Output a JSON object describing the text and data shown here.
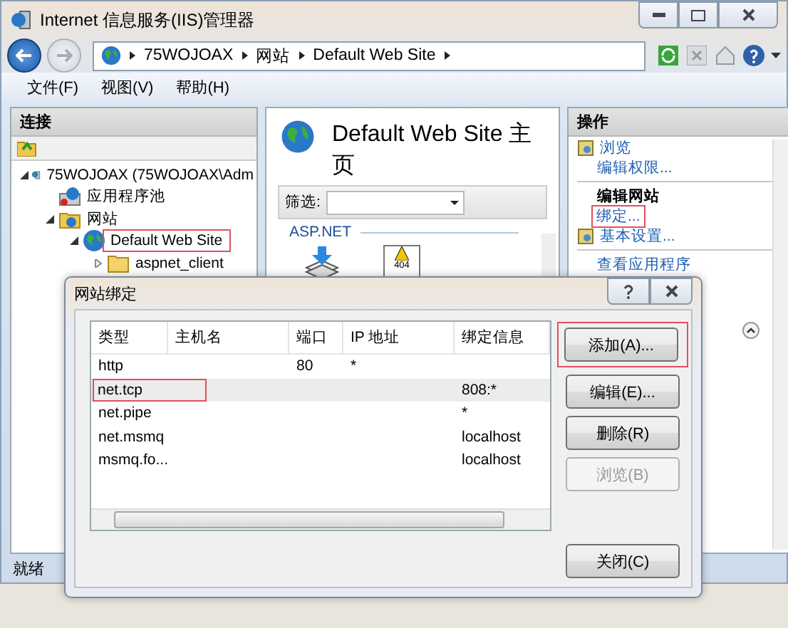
{
  "window": {
    "title": "Internet 信息服务(IIS)管理器"
  },
  "address_bar": {
    "crumbs": [
      "75WOJOAX",
      "网站",
      "Default Web Site"
    ]
  },
  "menu": [
    "文件(F)",
    "视图(V)",
    "帮助(H)"
  ],
  "connections": {
    "header": "连接",
    "tree": [
      {
        "label": "75WOJOAX (75WOJOAX\\Adm",
        "kind": "server",
        "expanded": true,
        "highlighted": false,
        "children": [
          {
            "label": "应用程序池",
            "kind": "pool",
            "highlighted": false
          },
          {
            "label": "网站",
            "kind": "sites",
            "expanded": true,
            "highlighted": false,
            "children": [
              {
                "label": "Default Web Site",
                "kind": "site",
                "expanded": true,
                "highlighted": true,
                "children": [
                  {
                    "label": "aspnet_client",
                    "kind": "folder",
                    "expanded": false,
                    "highlighted": false
                  }
                ]
              }
            ]
          }
        ]
      }
    ]
  },
  "home": {
    "title": "Default Web Site 主页",
    "filter_label": "筛选:",
    "group": "ASP.NET",
    "features": [
      {
        "kind": "compile"
      },
      {
        "kind": "error_pages",
        "badge": "404"
      }
    ]
  },
  "actions": {
    "header": "操作",
    "items": [
      {
        "kind": "icon_link",
        "label": "浏览",
        "highlighted": false
      },
      {
        "kind": "link",
        "label": "编辑权限...",
        "highlighted": false
      },
      {
        "kind": "separator"
      },
      {
        "kind": "heading",
        "label": "编辑网站"
      },
      {
        "kind": "link",
        "label": "绑定...",
        "highlighted": true
      },
      {
        "kind": "icon_link",
        "label": "基本设置...",
        "highlighted": false
      },
      {
        "kind": "separator"
      },
      {
        "kind": "link",
        "label": "查看应用程序",
        "highlighted": false
      }
    ]
  },
  "status_bar": {
    "text": "就绪"
  },
  "dialog": {
    "title": "网站绑定",
    "columns": [
      "类型",
      "主机名",
      "端口",
      "IP 地址",
      "绑定信息"
    ],
    "rows": [
      {
        "type": "http",
        "port": "80",
        "ip": "*",
        "selected": false,
        "highlighted": false
      },
      {
        "type": "net.tcp",
        "binding": "808:*",
        "selected": true,
        "highlighted": true
      },
      {
        "type": "net.pipe",
        "binding": "*",
        "selected": false,
        "highlighted": false
      },
      {
        "type": "net.msmq",
        "binding": "localhost",
        "selected": false,
        "highlighted": false
      },
      {
        "type": "msmq.fo...",
        "binding": "localhost",
        "selected": false,
        "highlighted": false
      }
    ],
    "buttons": [
      {
        "label": "添加(A)...",
        "disabled": false,
        "highlighted": true
      },
      {
        "label": "编辑(E)...",
        "disabled": false,
        "highlighted": false
      },
      {
        "label": "删除(R)",
        "disabled": false,
        "highlighted": false
      },
      {
        "label": "浏览(B)",
        "disabled": true,
        "highlighted": false
      }
    ],
    "close_button": "关闭(C)"
  }
}
